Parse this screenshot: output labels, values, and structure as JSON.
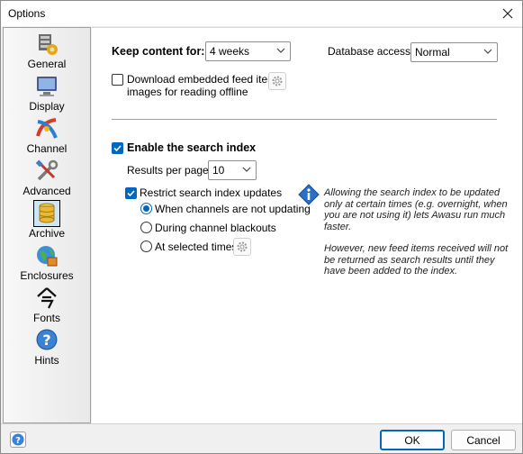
{
  "window": {
    "title": "Options"
  },
  "sidebar": {
    "items": [
      {
        "label": "General",
        "icon": "general-icon"
      },
      {
        "label": "Display",
        "icon": "display-icon"
      },
      {
        "label": "Channel",
        "icon": "channel-icon"
      },
      {
        "label": "Advanced",
        "icon": "advanced-icon"
      },
      {
        "label": "Archive",
        "icon": "archive-icon",
        "active": true
      },
      {
        "label": "Enclosures",
        "icon": "enclosures-icon"
      },
      {
        "label": "Fonts",
        "icon": "fonts-icon"
      },
      {
        "label": "Hints",
        "icon": "hints-icon"
      }
    ]
  },
  "archive": {
    "keep_content_label": "Keep content for:",
    "keep_content_value": "4 weeks",
    "database_access_label": "Database access:",
    "database_access_value": "Normal",
    "download_images_label_line1": "Download embedded feed item",
    "download_images_label_line2": "images for reading offline",
    "download_images_checked": false,
    "enable_search_index_label": "Enable the search index",
    "enable_search_index_checked": true,
    "results_per_page_label": "Results per page:",
    "results_per_page_value": "10",
    "restrict_updates_label": "Restrict search index updates",
    "restrict_updates_checked": true,
    "radio_options": [
      {
        "label": "When channels are not updating",
        "checked": true
      },
      {
        "label": "During channel blackouts",
        "checked": false
      },
      {
        "label": "At selected times",
        "checked": false
      }
    ],
    "info_paragraph_1": "Allowing the search index to be updated only at certain times (e.g. overnight, when you are not using it) lets Awasu run much faster.",
    "info_paragraph_2": "However, new feed items received will not be returned as search results until they have been added to the index."
  },
  "footer": {
    "ok_label": "OK",
    "cancel_label": "Cancel"
  },
  "colors": {
    "accent": "#0067c0",
    "info_icon": "#2a6fc9"
  }
}
